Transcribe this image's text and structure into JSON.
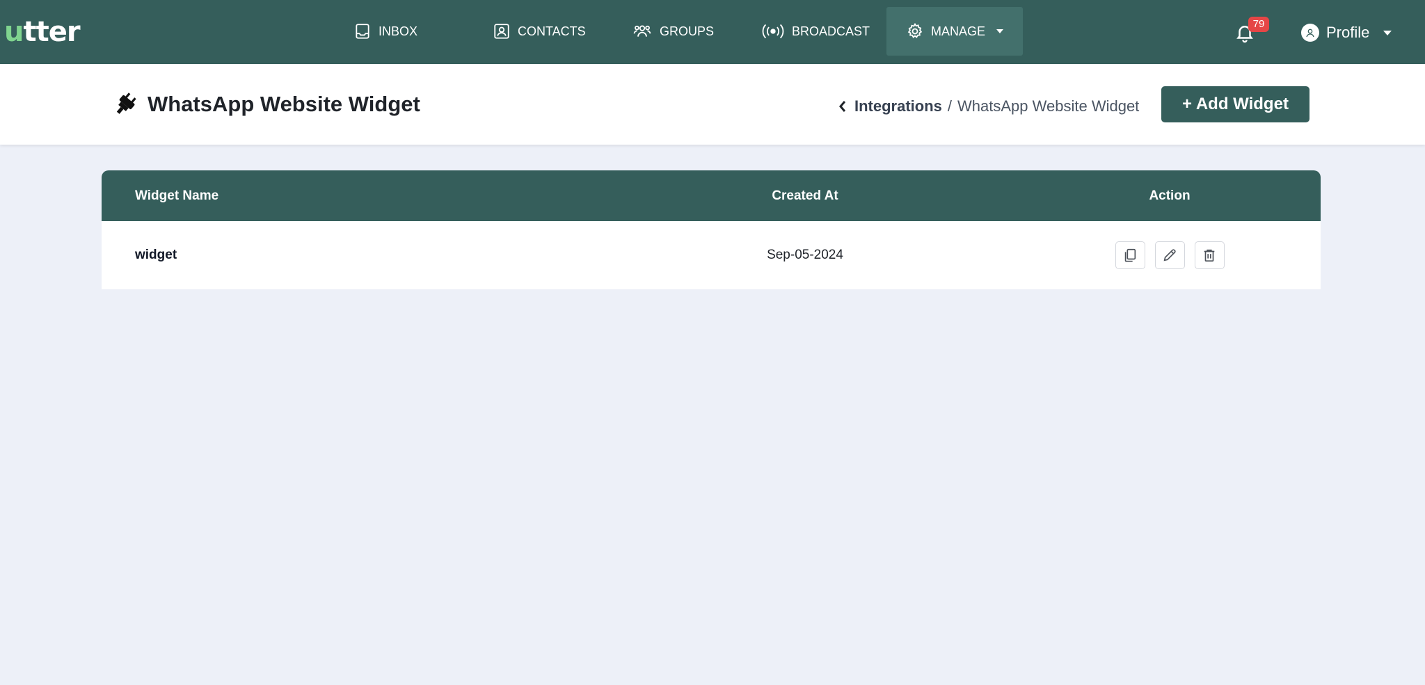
{
  "app": {
    "logo_first": "u",
    "logo_rest": "tter"
  },
  "nav": {
    "inbox": "INBOX",
    "contacts": "CONTACTS",
    "groups": "GROUPS",
    "broadcast": "BROADCAST",
    "manage": "MANAGE"
  },
  "notifications": {
    "count": "79"
  },
  "profile": {
    "label": "Profile"
  },
  "page": {
    "title": "WhatsApp Website Widget",
    "breadcrumb_parent": "Integrations",
    "breadcrumb_sep": "/",
    "breadcrumb_current": "WhatsApp Website Widget",
    "add_button": "+ Add Widget"
  },
  "table": {
    "headers": {
      "name": "Widget Name",
      "created": "Created At",
      "action": "Action"
    },
    "rows": [
      {
        "name": "widget",
        "created": "Sep-05-2024"
      }
    ]
  },
  "colors": {
    "primary": "#355e5b",
    "accent_logo": "#7fd48f",
    "badge": "#e54646",
    "background": "#edf0f8"
  },
  "icons": {
    "inbox": "inbox-icon",
    "contacts": "contact-card-icon",
    "groups": "users-icon",
    "broadcast": "broadcast-icon",
    "manage": "gear-icon",
    "bell": "bell-icon",
    "profile": "user-circle-icon",
    "title": "plug-icon",
    "copy": "copy-icon",
    "edit": "pencil-icon",
    "delete": "trash-icon"
  }
}
